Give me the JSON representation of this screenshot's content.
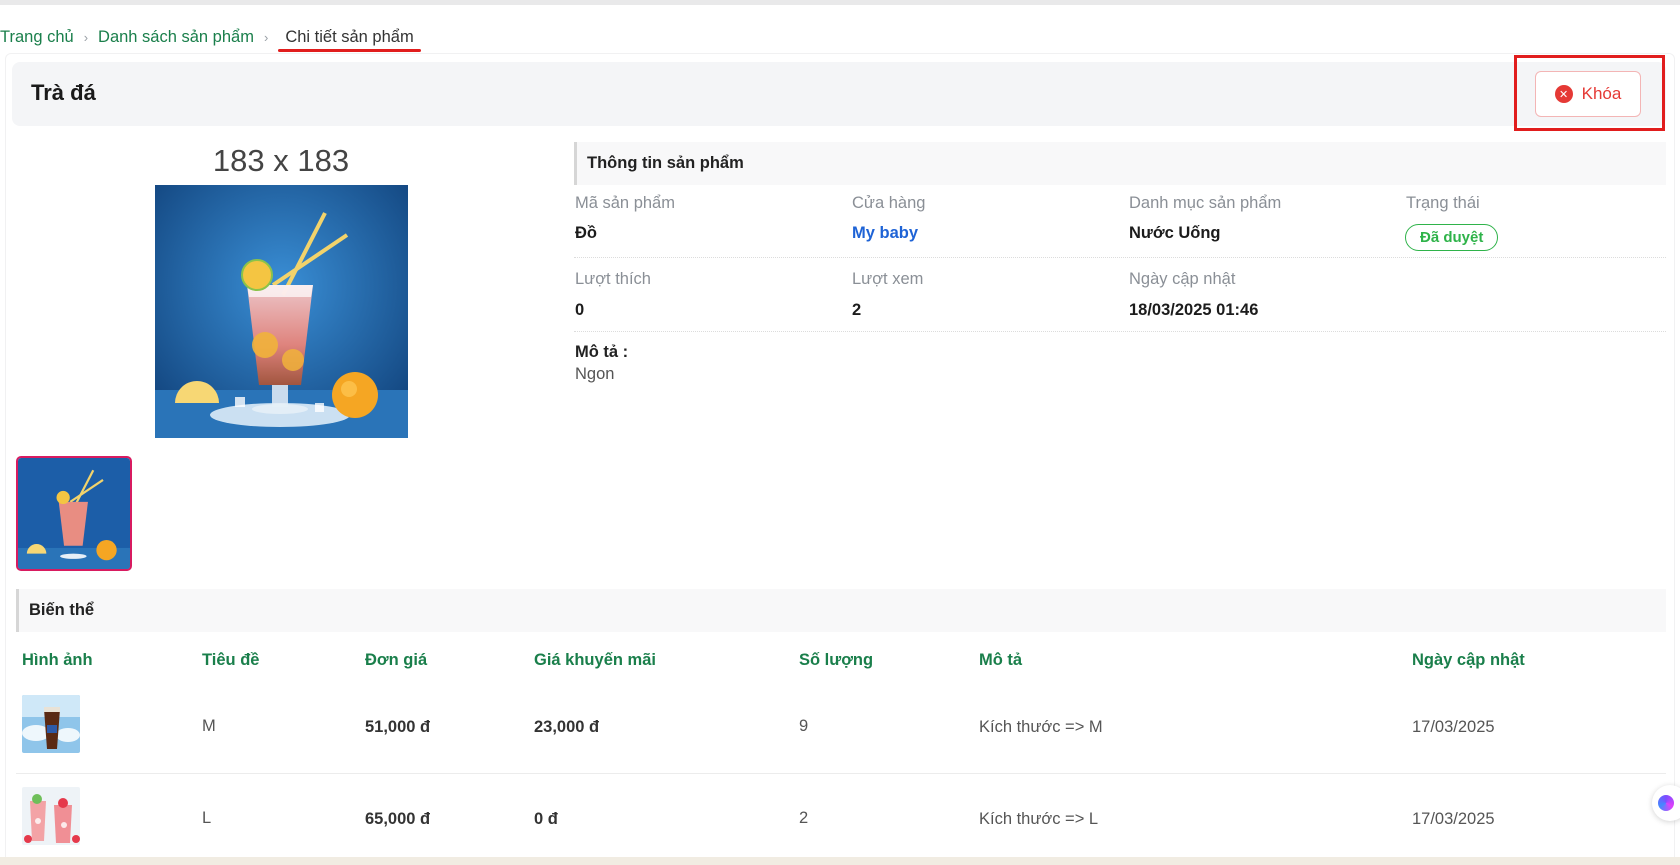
{
  "breadcrumb": {
    "home": "Trang chủ",
    "list": "Danh sách sản phẩm",
    "current": "Chi tiết sản phẩm",
    "separator": "›"
  },
  "header": {
    "title": "Trà đá",
    "lock_button": "Khóa",
    "lock_icon": "x-circle-icon"
  },
  "gallery": {
    "size_label": "183 x 183"
  },
  "info": {
    "section_title": "Thông tin sản phẩm",
    "code_label": "Mã sản phẩm",
    "code_value": "Đồ",
    "store_label": "Cửa hàng",
    "store_value": "My baby",
    "category_label": "Danh mục sản phẩm",
    "category_value": "Nước Uống",
    "status_label": "Trạng thái",
    "status_value": "Đã duyệt",
    "likes_label": "Lượt thích",
    "likes_value": "0",
    "views_label": "Lượt xem",
    "views_value": "2",
    "updated_label": "Ngày cập nhật",
    "updated_value": "18/03/2025 01:46",
    "description_label": "Mô tả :",
    "description_value": "Ngon"
  },
  "variants": {
    "section_title": "Biến thể",
    "columns": [
      "Hình ảnh",
      "Tiêu đề",
      "Đơn giá",
      "Giá khuyến mãi",
      "Số lượng",
      "Mô tả",
      "Ngày cập nhật"
    ],
    "rows": [
      {
        "title": "M",
        "price": "51,000 đ",
        "sale_price": "23,000 đ",
        "quantity": "9",
        "description": "Kích thước => M",
        "updated": "17/03/2025"
      },
      {
        "title": "L",
        "price": "65,000 đ",
        "sale_price": "0 đ",
        "quantity": "2",
        "description": "Kích thước => L",
        "updated": "17/03/2025"
      }
    ]
  },
  "colors": {
    "accent_green": "#1a7f4b",
    "danger_red": "#e53935",
    "link_blue": "#1e63d6",
    "status_green": "#2fb34a"
  }
}
